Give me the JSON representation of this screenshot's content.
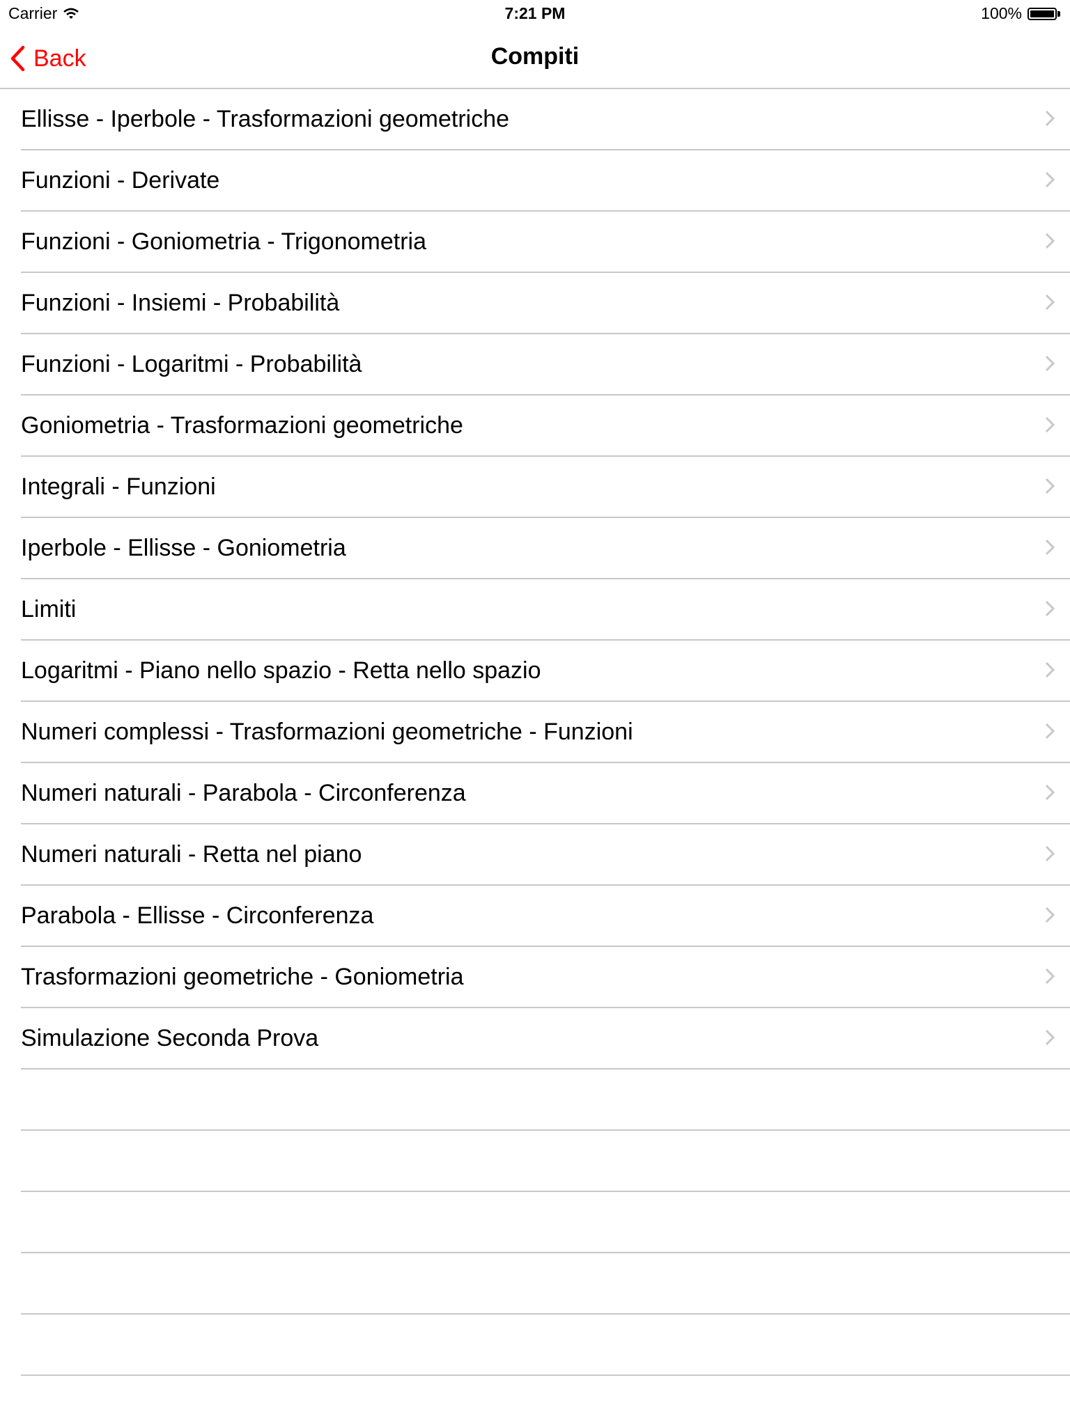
{
  "status_bar": {
    "carrier": "Carrier",
    "time": "7:21 PM",
    "battery_text": "100%",
    "battery_level": 1.0
  },
  "nav": {
    "back_label": "Back",
    "title": "Compiti"
  },
  "accent_color": "#ff0000",
  "items": [
    {
      "label": "Ellisse - Iperbole - Trasformazioni geometriche"
    },
    {
      "label": "Funzioni - Derivate"
    },
    {
      "label": "Funzioni - Goniometria - Trigonometria"
    },
    {
      "label": "Funzioni - Insiemi - Probabilità"
    },
    {
      "label": "Funzioni - Logaritmi - Probabilità"
    },
    {
      "label": "Goniometria - Trasformazioni geometriche"
    },
    {
      "label": "Integrali - Funzioni"
    },
    {
      "label": "Iperbole - Ellisse - Goniometria"
    },
    {
      "label": "Limiti"
    },
    {
      "label": "Logaritmi - Piano nello spazio - Retta nello spazio"
    },
    {
      "label": "Numeri complessi - Trasformazioni geometriche - Funzioni"
    },
    {
      "label": "Numeri naturali - Parabola - Circonferenza"
    },
    {
      "label": "Numeri naturali - Retta nel piano"
    },
    {
      "label": "Parabola - Ellisse - Circonferenza"
    },
    {
      "label": "Trasformazioni geometriche - Goniometria"
    },
    {
      "label": "Simulazione Seconda Prova"
    }
  ],
  "empty_rows": 5
}
